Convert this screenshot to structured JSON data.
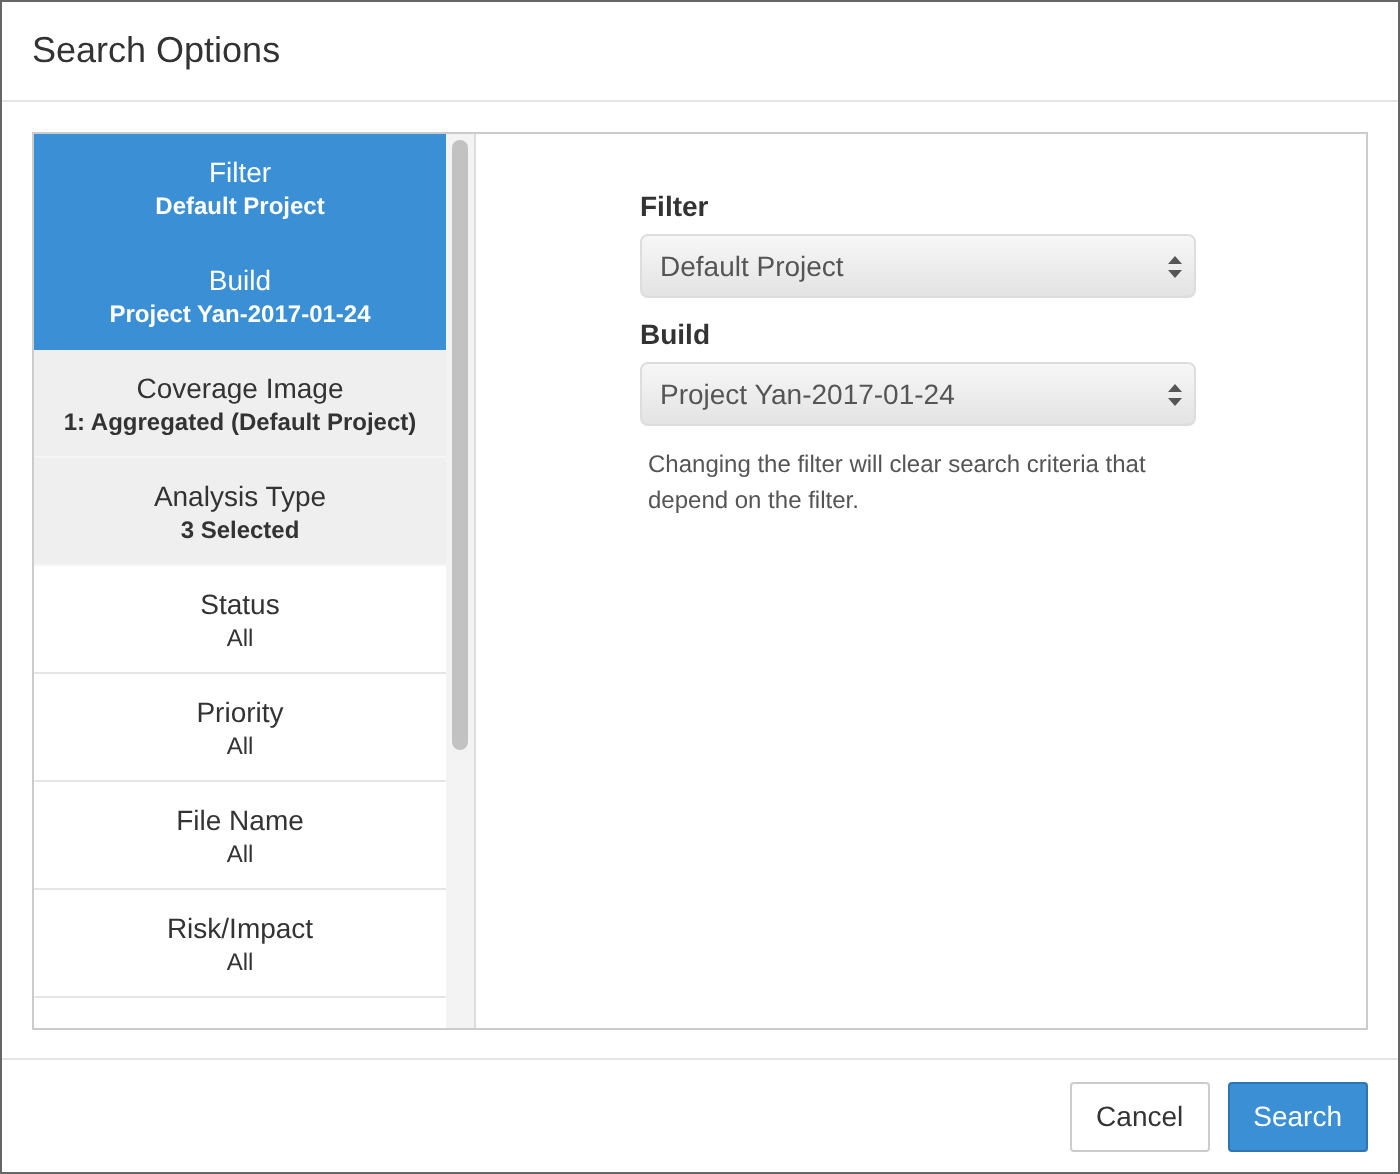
{
  "window": {
    "title": "Search Options"
  },
  "sidebar": {
    "items": [
      {
        "label": "Filter",
        "value": "Default Project",
        "selected": true,
        "modified": true
      },
      {
        "label": "Build",
        "value": "Project Yan-2017-01-24",
        "selected": true,
        "modified": true
      },
      {
        "label": "Coverage Image",
        "value": "1: Aggregated (Default Project)",
        "selected": false,
        "modified": true
      },
      {
        "label": "Analysis Type",
        "value": "3 Selected",
        "selected": false,
        "modified": true
      },
      {
        "label": "Status",
        "value": "All",
        "selected": false,
        "modified": false
      },
      {
        "label": "Priority",
        "value": "All",
        "selected": false,
        "modified": false
      },
      {
        "label": "File Name",
        "value": "All",
        "selected": false,
        "modified": false
      },
      {
        "label": "Risk/Impact",
        "value": "All",
        "selected": false,
        "modified": false
      }
    ]
  },
  "form": {
    "fields": [
      {
        "label": "Filter",
        "value": "Default Project"
      },
      {
        "label": "Build",
        "value": "Project Yan-2017-01-24"
      }
    ],
    "help": "Changing the filter will clear search criteria that depend on the filter."
  },
  "buttons": [
    {
      "label": "Cancel",
      "kind": "default"
    },
    {
      "label": "Search",
      "kind": "primary"
    }
  ]
}
